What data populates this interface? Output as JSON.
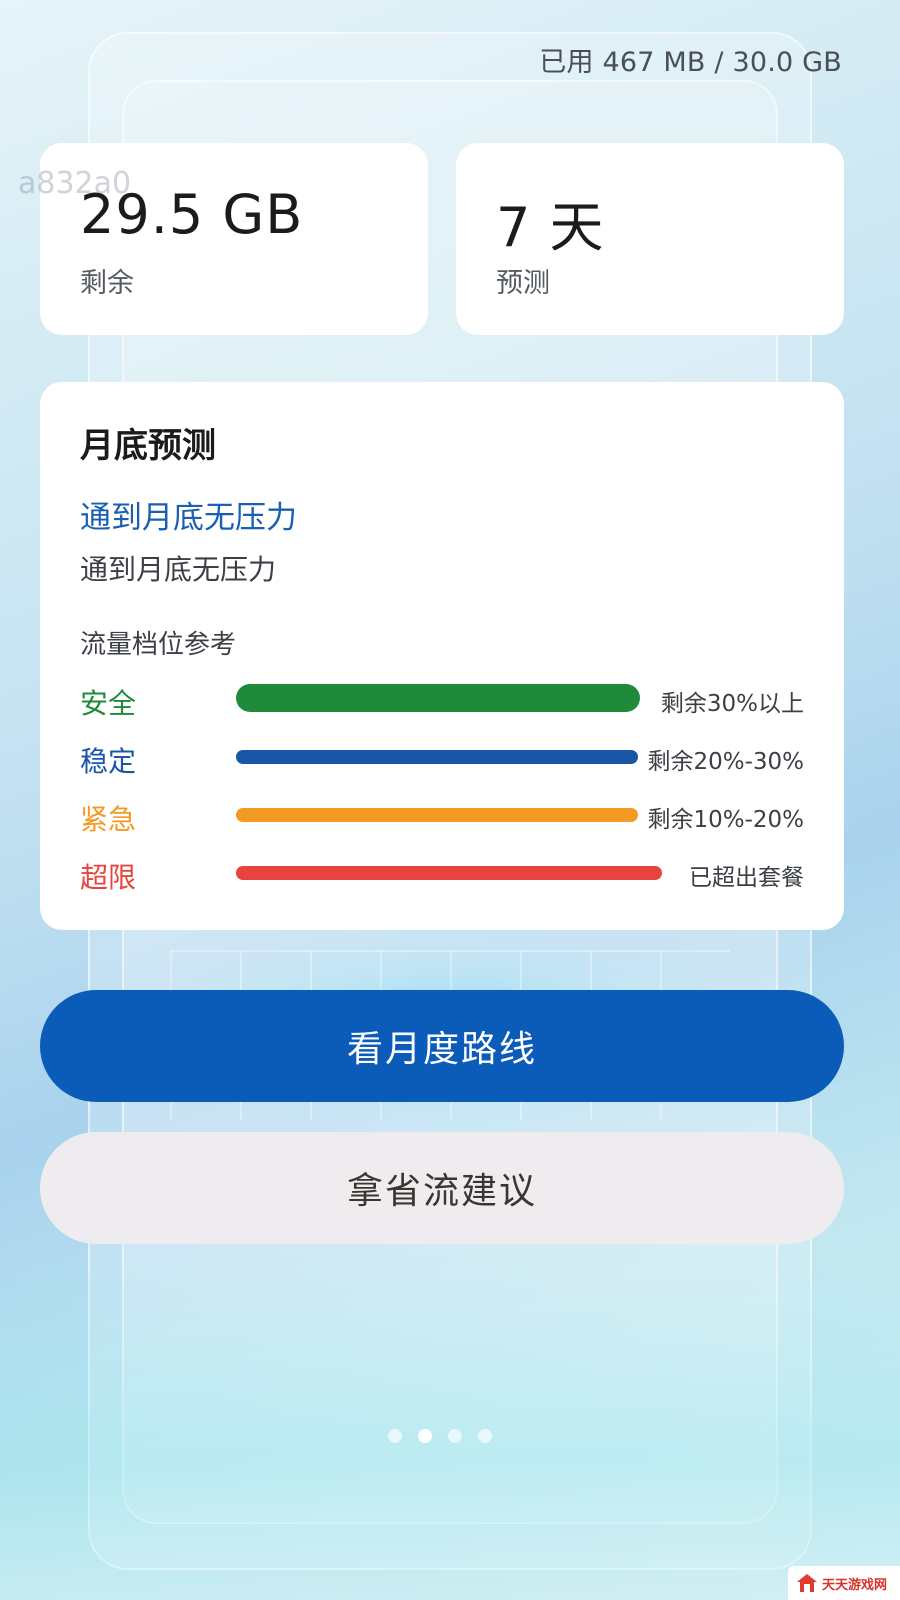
{
  "header": {
    "usage": "已用 467 MB / 30.0 GB",
    "id_watermark": "a832a0"
  },
  "stats": {
    "remaining": {
      "value": "29.5 GB",
      "label": "剩余"
    },
    "forecast": {
      "value": "7 天",
      "label": "预测"
    }
  },
  "forecast_card": {
    "title": "月底预测",
    "headline": "通到月底无压力",
    "subtitle": "通到月底无压力",
    "tier_heading": "流量档位参考",
    "tiers": [
      {
        "name": "安全",
        "desc": "剩余30%以上",
        "color": "#1f8a3a"
      },
      {
        "name": "稳定",
        "desc": "剩余20%-30%",
        "color": "#1a56a8"
      },
      {
        "name": "紧急",
        "desc": "剩余10%-20%",
        "color": "#f29a24"
      },
      {
        "name": "超限",
        "desc": "已超出套餐",
        "color": "#e8443f"
      }
    ]
  },
  "buttons": {
    "primary_label": "看月度路线",
    "secondary_label": "拿省流建议"
  },
  "pager": {
    "count": 4,
    "active_index": 1
  },
  "badge": {
    "text": "天天游戏网"
  },
  "colors": {
    "primary": "#0b5bb8",
    "headline": "#1a5fb0"
  }
}
